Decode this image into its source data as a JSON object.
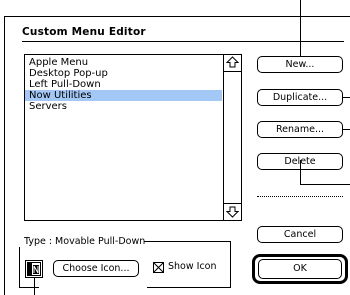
{
  "dialog": {
    "title": "Custom Menu Editor"
  },
  "menu_list": {
    "items": [
      {
        "label": "Apple Menu",
        "selected": false
      },
      {
        "label": "Desktop Pop-up",
        "selected": false
      },
      {
        "label": "Left Pull-Down",
        "selected": false
      },
      {
        "label": "Now Utilities",
        "selected": true
      },
      {
        "label": "Servers",
        "selected": false
      }
    ]
  },
  "buttons": {
    "new": "New...",
    "duplicate": "Duplicate...",
    "rename": "Rename...",
    "delete": "Delete",
    "cancel": "Cancel",
    "ok": "OK"
  },
  "type_group": {
    "type_label": "Type : Movable Pull-Down",
    "choose_icon": "Choose Icon...",
    "show_icon_label": "Show Icon",
    "show_icon_checked": true
  },
  "colors": {
    "selection": "#a4c8f5"
  }
}
